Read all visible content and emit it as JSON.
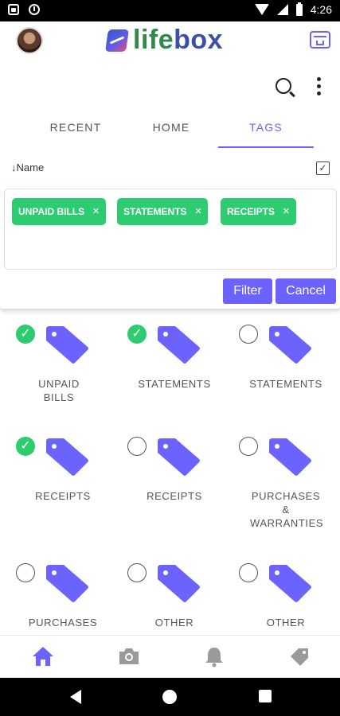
{
  "status_bar": {
    "time": "4:26"
  },
  "header": {
    "logo_part1": "life",
    "logo_part2": "box"
  },
  "tabs": [
    {
      "label": "RECENT",
      "active": false
    },
    {
      "label": "HOME",
      "active": false
    },
    {
      "label": "TAGS",
      "active": true
    }
  ],
  "sort": {
    "label": "Name",
    "arrow": "↓",
    "checkbox_mark": "✓"
  },
  "filter": {
    "chips": [
      {
        "label": "UNPAID BILLS",
        "remove": "×"
      },
      {
        "label": "STATEMENTS",
        "remove": "×"
      },
      {
        "label": "RECEIPTS",
        "remove": "×"
      }
    ],
    "filter_label": "Filter",
    "cancel_label": "Cancel"
  },
  "tags": [
    {
      "label": "UNPAID BILLS",
      "selected": true
    },
    {
      "label": "STATEMENTS",
      "selected": true
    },
    {
      "label": "STATEMENTS",
      "selected": false
    },
    {
      "label": "RECEIPTS",
      "selected": true
    },
    {
      "label": "RECEIPTS",
      "selected": false
    },
    {
      "label": "PURCHASES & WARRANTIES",
      "selected": false
    },
    {
      "label": "PURCHASES",
      "selected": false
    },
    {
      "label": "OTHER",
      "selected": false
    },
    {
      "label": "OTHER",
      "selected": false
    }
  ],
  "bottom_nav": [
    "home-icon",
    "camera-icon",
    "bell-icon",
    "tag-icon"
  ],
  "colors": {
    "accent": "#6c63ff",
    "chip_green": "#2ecc71",
    "text_muted": "#555555"
  }
}
